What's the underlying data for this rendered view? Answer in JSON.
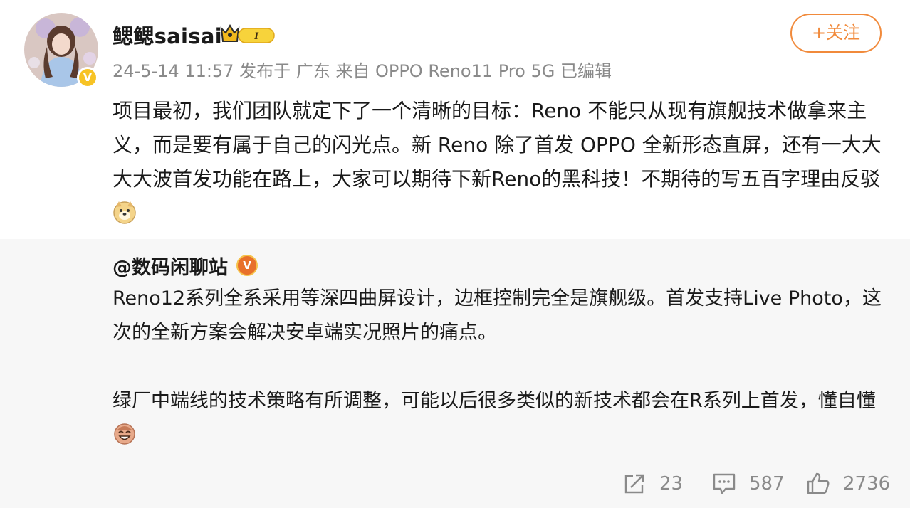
{
  "post": {
    "username": "鳃鳃saisai",
    "level_badge": "I",
    "meta": "24-5-14 11:57  发布于 广东  来自 OPPO Reno11 Pro 5G  已编辑",
    "follow_label": "+关注",
    "content": "项目最初，我们团队就定下了一个清晰的目标：Reno 不能只从现有旗舰技术做拿来主义，而是要有属于自己的闪光点。新 Reno 除了首发 OPPO 全新形态直屏，还有一大大大大波首发功能在路上，大家可以期待下新Reno的黑科技！不期待的写五百字理由反驳"
  },
  "repost": {
    "author": "@数码闲聊站",
    "para1": "Reno12系列全系采用等深四曲屏设计，边框控制完全是旗舰级。首发支持Live Photo，这次的全新方案会解决安卓端实况照片的痛点。",
    "para2": "绿厂中端线的技术策略有所调整，可能以后很多类似的新技术都会在R系列上首发，懂自懂"
  },
  "actions": {
    "share_count": "23",
    "comment_count": "587",
    "like_count": "2736"
  },
  "colors": {
    "accent": "#f18a3b",
    "meta_text": "#8a8a8a",
    "repost_bg": "#f7f7f7"
  },
  "icons": [
    "verified-v-icon",
    "crown-level-icon",
    "doge-emoji-icon",
    "laugh-emoji-icon",
    "share-icon",
    "comment-icon",
    "like-icon"
  ]
}
